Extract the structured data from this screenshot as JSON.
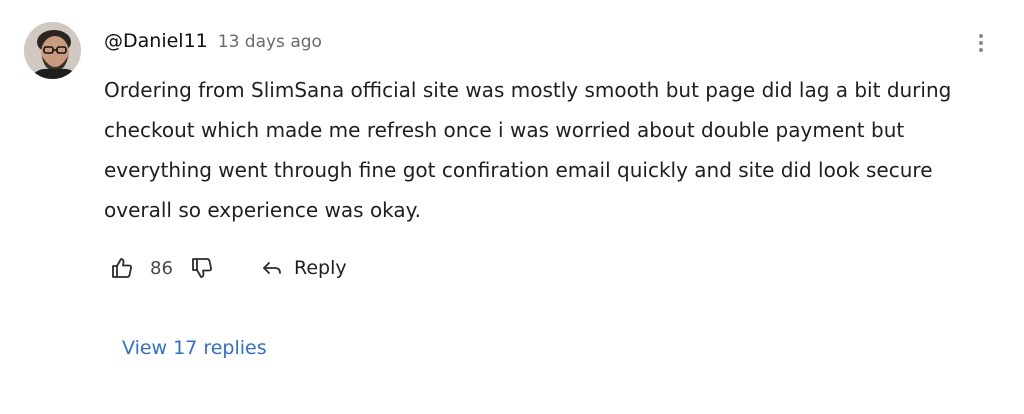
{
  "comment": {
    "author": "@Daniel11",
    "timestamp": "13 days ago",
    "text": "Ordering from SlimSana official site was mostly smooth but page did lag a bit during checkout which made me refresh once i was worried about double payment but everything went through fine got confiration email quickly and site did look secure overall so experience was okay.",
    "like_count": "86",
    "reply_label": "Reply",
    "view_replies_label": "View 17 replies",
    "icons": {
      "avatar": "user-avatar",
      "menu": "more-vertical-icon",
      "like": "thumbs-up-icon",
      "dislike": "thumbs-down-icon",
      "reply": "reply-arrow-icon"
    },
    "colors": {
      "link": "#2e6fd6",
      "meta": "#6b6b6b",
      "text": "#1f1f1f"
    }
  }
}
